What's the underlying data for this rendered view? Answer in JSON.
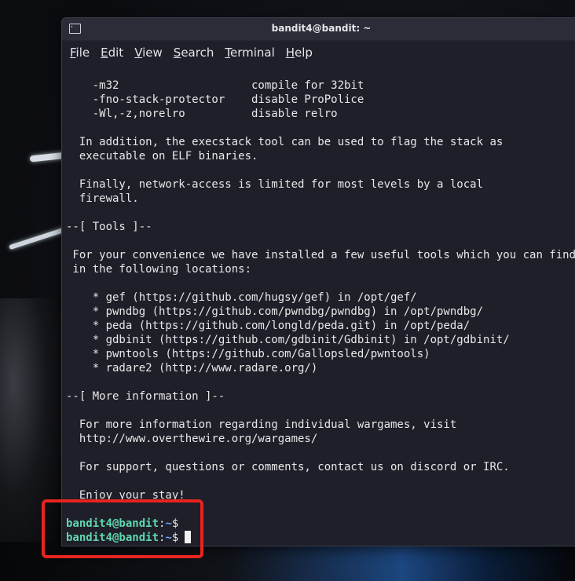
{
  "window": {
    "title": "bandit4@bandit: ~",
    "app_icon": "terminal-icon"
  },
  "menu": [
    {
      "mnemonic": "F",
      "rest": "ile"
    },
    {
      "mnemonic": "E",
      "rest": "dit"
    },
    {
      "mnemonic": "V",
      "rest": "iew"
    },
    {
      "mnemonic": "S",
      "rest": "earch"
    },
    {
      "mnemonic": "T",
      "rest": "erminal"
    },
    {
      "mnemonic": "H",
      "rest": "elp"
    }
  ],
  "terminal": {
    "lines": [
      "",
      "    -m32                    compile for 32bit",
      "    -fno-stack-protector    disable ProPolice",
      "    -Wl,-z,norelro          disable relro",
      "",
      "  In addition, the execstack tool can be used to flag the stack as",
      "  executable on ELF binaries.",
      "",
      "  Finally, network-access is limited for most levels by a local",
      "  firewall.",
      "",
      "--[ Tools ]--",
      "",
      " For your convenience we have installed a few useful tools which you can find",
      " in the following locations:",
      "",
      "    * gef (https://github.com/hugsy/gef) in /opt/gef/",
      "    * pwndbg (https://github.com/pwndbg/pwndbg) in /opt/pwndbg/",
      "    * peda (https://github.com/longld/peda.git) in /opt/peda/",
      "    * gdbinit (https://github.com/gdbinit/Gdbinit) in /opt/gdbinit/",
      "    * pwntools (https://github.com/Gallopsled/pwntools)",
      "    * radare2 (http://www.radare.org/)",
      "",
      "--[ More information ]--",
      "",
      "  For more information regarding individual wargames, visit",
      "  http://www.overthewire.org/wargames/",
      "",
      "  For support, questions or comments, contact us on discord or IRC.",
      "",
      "  Enjoy your stay!",
      ""
    ],
    "prompts": [
      {
        "user": "bandit4@bandit",
        "sep": ":",
        "path": "~",
        "symbol": "$"
      },
      {
        "user": "bandit4@bandit",
        "sep": ":",
        "path": "~",
        "symbol": "$"
      }
    ]
  },
  "colors": {
    "terminal_bg": "#1e1f29",
    "prompt_user": "#5fd7af",
    "prompt_path": "#6aa7ff",
    "annotation": "#e8241e"
  }
}
